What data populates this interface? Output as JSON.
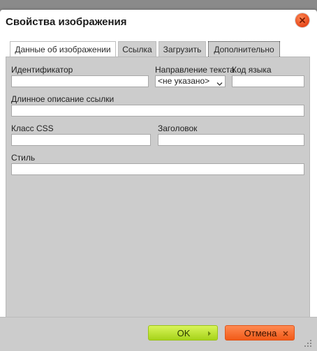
{
  "dialog": {
    "title": "Свойства изображения",
    "close_icon": "close-icon",
    "accent_close": "#e5461a"
  },
  "tabs": [
    {
      "label": "Данные об изображении"
    },
    {
      "label": "Ссылка"
    },
    {
      "label": "Загрузить"
    },
    {
      "label": "Дополнительно",
      "active": true
    }
  ],
  "fields": {
    "id_label": "Идентификатор",
    "id_value": "",
    "direction_label": "Направление текста",
    "direction_value": "<не указано>",
    "lang_label": "Код языка",
    "lang_value": "",
    "longdesc_label": "Длинное описание ссылки",
    "longdesc_value": "",
    "class_label": "Класс CSS",
    "class_value": "",
    "title_label": "Заголовок",
    "title_value": "",
    "style_label": "Стиль",
    "style_value": ""
  },
  "buttons": {
    "ok_label": "OK",
    "ok_icon": "play-icon",
    "cancel_label": "Отмена",
    "cancel_icon": "x-icon",
    "ok_color": "#a6d31a",
    "cancel_color": "#f15a18"
  }
}
